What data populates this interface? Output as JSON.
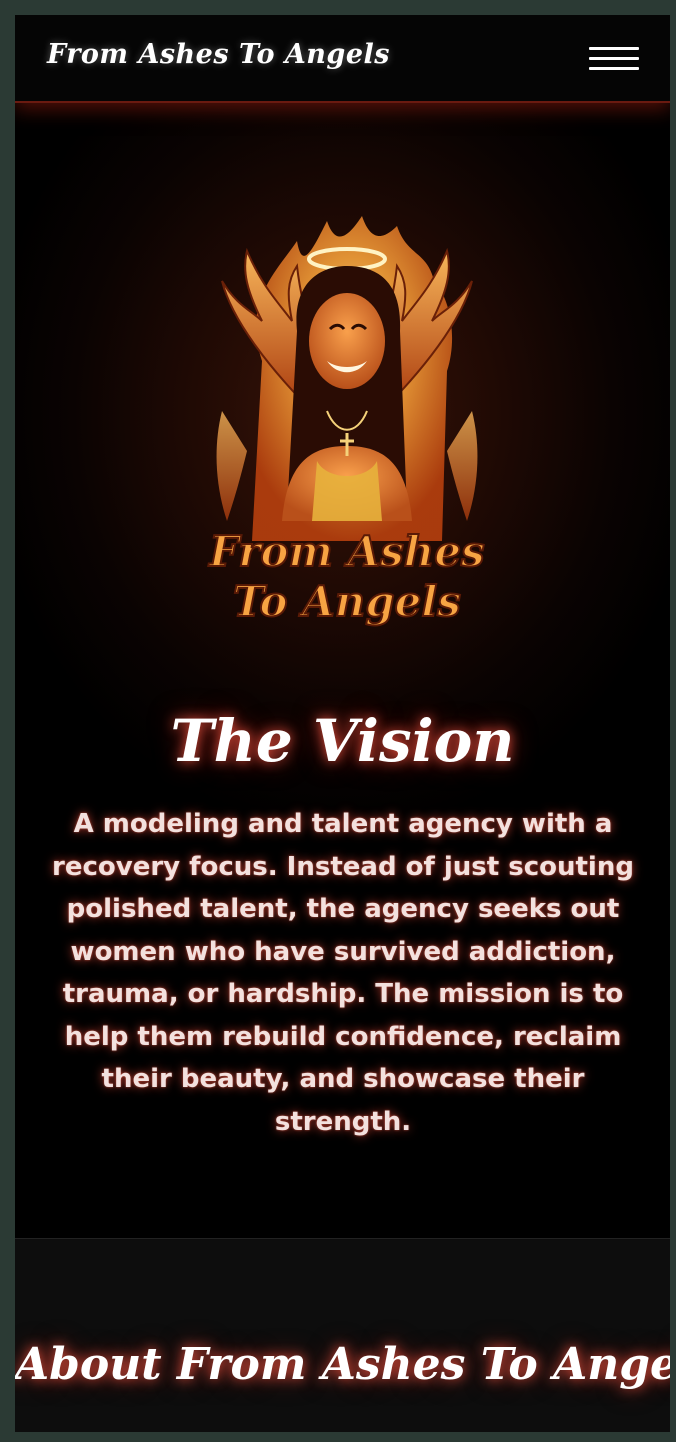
{
  "navbar": {
    "brand": "From Ashes To Angels",
    "menu_icon": "hamburger-menu-icon"
  },
  "hero": {
    "logo": {
      "icon": "angel-flame-logo",
      "line1": "From Ashes",
      "line2": "To Angels"
    },
    "vision_title": "The Vision",
    "vision_text": "A modeling and talent agency with a recovery focus. Instead of just scouting polished talent, the agency seeks out women who have survived addiction, trauma, or hardship. The mission is to help them rebuild confidence, reclaim their beauty, and showcase their strength."
  },
  "about": {
    "title": "About From Ashes To Angels"
  },
  "colors": {
    "background": "#000000",
    "frame": "#2b3a34",
    "glow": "#ff5a46",
    "logo_orange": "#f08a24"
  }
}
